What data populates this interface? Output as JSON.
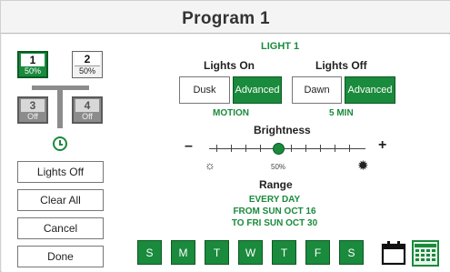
{
  "header": {
    "title": "Program 1"
  },
  "zones": [
    {
      "num": "1",
      "sub": "50%"
    },
    {
      "num": "2",
      "sub": "50%"
    },
    {
      "num": "3",
      "sub": "Off"
    },
    {
      "num": "4",
      "sub": "Off"
    }
  ],
  "side_buttons": {
    "lights_off": "Lights Off",
    "clear_all": "Clear All",
    "cancel": "Cancel",
    "done": "Done"
  },
  "light": {
    "label": "LIGHT 1",
    "lights_on": {
      "label": "Lights On",
      "options": [
        "Dusk",
        "Advanced"
      ],
      "selected": "Advanced",
      "note": "MOTION"
    },
    "lights_off": {
      "label": "Lights Off",
      "options": [
        "Dawn",
        "Advanced"
      ],
      "selected": "Advanced",
      "note": "5 MIN"
    }
  },
  "brightness": {
    "label": "Brightness",
    "value_text": "50%",
    "value": 0.5,
    "minus": "–",
    "plus": "+"
  },
  "range": {
    "label": "Range",
    "lines": [
      "EVERY DAY",
      "FROM SUN OCT 16",
      "TO FRI SUN OCT 30"
    ]
  },
  "days": [
    "S",
    "M",
    "T",
    "W",
    "T",
    "F",
    "S"
  ],
  "colors": {
    "accent": "#1a8a3c",
    "accent_dark": "#0c5a24",
    "disabled": "#8c8c8c"
  },
  "icons": [
    "clock-icon",
    "sun-dim-icon",
    "sun-bright-icon",
    "calendar-icon",
    "calendar-grid-icon"
  ]
}
